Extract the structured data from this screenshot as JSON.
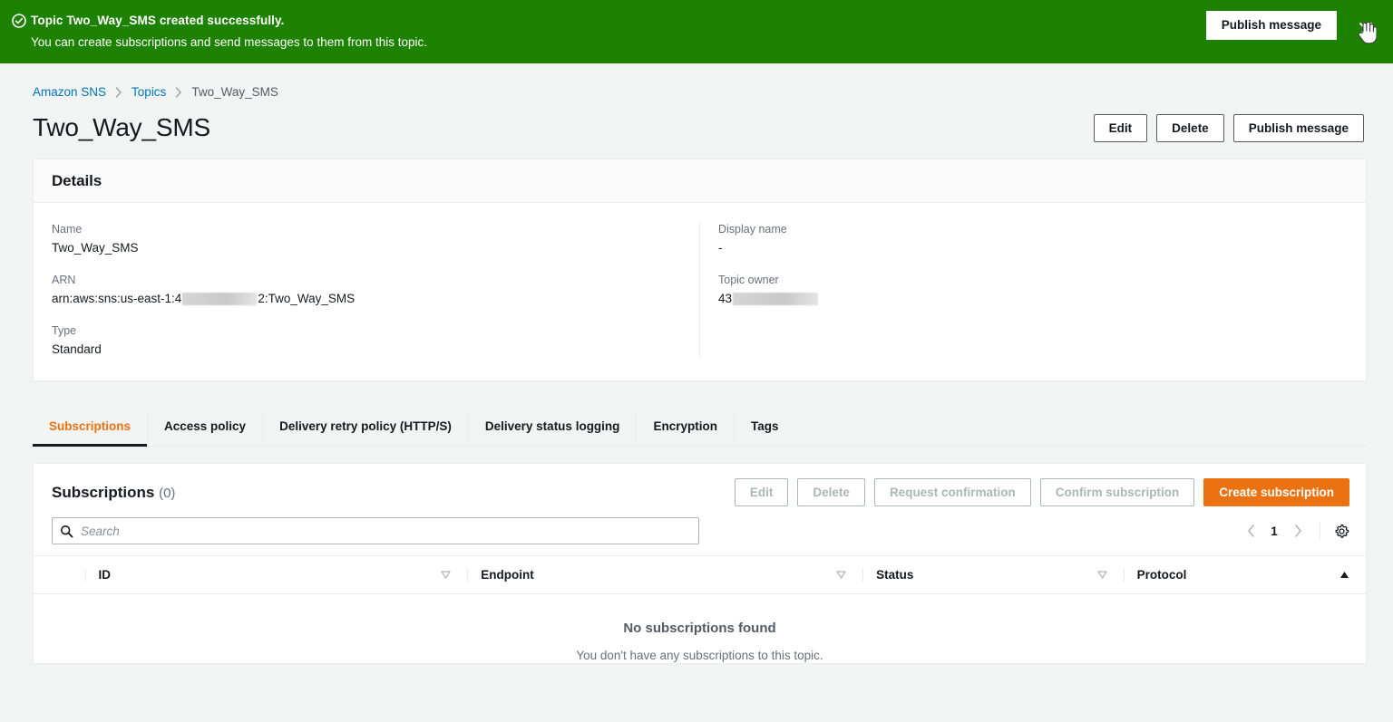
{
  "flashbar": {
    "icon": "check-circle-icon",
    "title": "Topic Two_Way_SMS created successfully.",
    "subtitle": "You can create subscriptions and send messages to them from this topic.",
    "publish_label": "Publish message",
    "close_icon": "close-icon",
    "background_color": "#1d8102"
  },
  "breadcrumb": {
    "items": [
      {
        "label": "Amazon SNS",
        "is_link": true
      },
      {
        "label": "Topics",
        "is_link": true
      },
      {
        "label": "Two_Way_SMS",
        "is_link": false
      }
    ],
    "link_color": "#0073bb"
  },
  "header": {
    "title": "Two_Way_SMS",
    "actions": [
      {
        "label": "Edit",
        "variant": "normal"
      },
      {
        "label": "Delete",
        "variant": "normal"
      },
      {
        "label": "Publish message",
        "variant": "normal"
      }
    ]
  },
  "details": {
    "heading": "Details",
    "left": [
      {
        "label": "Name",
        "value": "Two_Way_SMS",
        "redacted": false
      },
      {
        "label": "ARN",
        "value_prefix": "arn:aws:sns:us-east-1:4",
        "value_suffix": "2:Two_Way_SMS",
        "redacted": true
      },
      {
        "label": "Type",
        "value": "Standard",
        "redacted": false
      }
    ],
    "right": [
      {
        "label": "Display name",
        "value": "-",
        "redacted": false
      },
      {
        "label": "Topic owner",
        "value_prefix": "43",
        "value_suffix": "",
        "redacted": true
      }
    ]
  },
  "tabs": {
    "active": "Subscriptions",
    "items": [
      {
        "label": "Subscriptions"
      },
      {
        "label": "Access policy"
      },
      {
        "label": "Delivery retry policy (HTTP/S)"
      },
      {
        "label": "Delivery status logging"
      },
      {
        "label": "Encryption"
      },
      {
        "label": "Tags"
      }
    ],
    "active_color": "#ec7211"
  },
  "subscriptions": {
    "title": "Subscriptions",
    "count": "(0)",
    "actions": [
      {
        "label": "Edit",
        "disabled": true
      },
      {
        "label": "Delete",
        "disabled": true
      },
      {
        "label": "Request confirmation",
        "disabled": true
      },
      {
        "label": "Confirm subscription",
        "disabled": true
      },
      {
        "label": "Create subscription",
        "disabled": false,
        "primary": true,
        "color": "#ec7211"
      }
    ],
    "search": {
      "placeholder": "Search",
      "value": "",
      "icon": "search-icon"
    },
    "pagination": {
      "prev_icon": "chevron-left-icon",
      "page": "1",
      "next_icon": "chevron-right-icon",
      "settings_icon": "gear-icon"
    },
    "table": {
      "columns": [
        {
          "label": "ID",
          "sorted": false,
          "sort_direction": "none"
        },
        {
          "label": "Endpoint",
          "sorted": false,
          "sort_direction": "none"
        },
        {
          "label": "Status",
          "sorted": false,
          "sort_direction": "none"
        },
        {
          "label": "Protocol",
          "sorted": true,
          "sort_direction": "asc"
        }
      ],
      "rows": []
    },
    "empty": {
      "title": "No subscriptions found",
      "subtitle": "You don't have any subscriptions to this topic."
    }
  }
}
